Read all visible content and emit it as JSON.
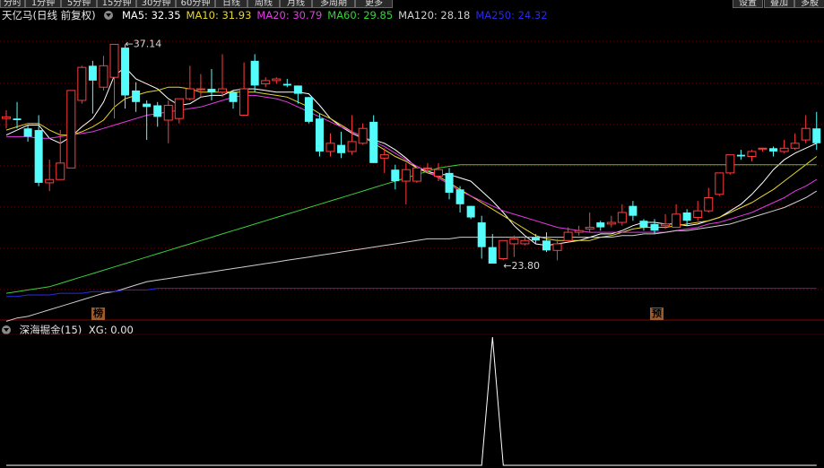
{
  "toolbar": {
    "left_tabs": [
      "分时",
      "1分钟",
      "5分钟",
      "15分钟",
      "30分钟",
      "60分钟",
      "日线",
      "周线",
      "月线",
      "多周期",
      "更多"
    ],
    "right_buttons": [
      "设置",
      "叠加",
      "多股"
    ]
  },
  "main_legend": {
    "title": "天亿马(日线 前复权)",
    "ma": [
      {
        "label": "MA5: 32.35",
        "color": "#ffffff"
      },
      {
        "label": "MA10: 31.93",
        "color": "#e6d52e"
      },
      {
        "label": "MA20: 30.79",
        "color": "#e43ae4"
      },
      {
        "label": "MA60: 29.85",
        "color": "#3ad03a"
      },
      {
        "label": "MA120: 28.18",
        "color": "#cfcfcf"
      },
      {
        "label": "MA250: 24.32",
        "color": "#2a2ae6"
      }
    ]
  },
  "sub_legend": {
    "title": "深海掘金(15)",
    "xg": "XG: 0.00"
  },
  "annotations": {
    "high": "37.14",
    "low": "23.80"
  },
  "markers": [
    "榜",
    "预"
  ],
  "colors": {
    "up": "#ff3c3c",
    "down": "#54fcfc",
    "grid": "#7a0000",
    "background": "#000000"
  },
  "chart_data": [
    {
      "type": "candlestick",
      "title": "天亿马(日线 前复权)",
      "ylim": [
        21.3,
        38.7
      ],
      "series": [
        {
          "name": "K",
          "ohlc": [
            [
              32.6,
              33.1,
              32.7,
              32.0
            ],
            [
              32.6,
              33.6,
              32.5,
              32.0
            ],
            [
              32.0,
              32.2,
              31.5,
              31.2
            ],
            [
              31.9,
              32.8,
              28.7,
              28.5
            ],
            [
              28.7,
              30.1,
              28.9,
              28.2
            ],
            [
              28.9,
              31.9,
              29.9,
              29.6
            ],
            [
              29.6,
              34.3,
              34.3,
              29.6
            ],
            [
              33.7,
              35.8,
              35.7,
              33.5
            ],
            [
              35.8,
              36.1,
              34.9,
              32.9
            ],
            [
              34.5,
              36.4,
              35.8,
              34.3
            ],
            [
              35.1,
              37.1,
              37.1,
              32.6
            ],
            [
              36.9,
              37.1,
              34.0,
              33.2
            ],
            [
              34.3,
              34.8,
              33.6,
              33.0
            ],
            [
              33.5,
              33.7,
              33.3,
              31.3
            ],
            [
              33.4,
              33.6,
              32.7,
              32.1
            ],
            [
              32.5,
              33.7,
              33.4,
              31.1
            ],
            [
              32.6,
              33.6,
              33.8,
              32.3
            ],
            [
              33.8,
              35.8,
              34.4,
              33.7
            ],
            [
              34.4,
              35.3,
              34.4,
              33.9
            ],
            [
              34.4,
              35.6,
              34.2,
              33.7
            ],
            [
              34.2,
              36.5,
              34.4,
              33.9
            ],
            [
              34.2,
              34.3,
              33.6,
              33.2
            ],
            [
              32.8,
              36.0,
              34.4,
              32.8
            ],
            [
              36.1,
              36.5,
              34.6,
              34.2
            ],
            [
              34.7,
              35.1,
              34.9,
              34.5
            ],
            [
              34.9,
              35.1,
              35.0,
              34.7
            ],
            [
              34.7,
              35.0,
              34.6,
              34.5
            ],
            [
              34.6,
              34.6,
              34.1,
              33.5
            ],
            [
              33.9,
              33.9,
              32.4,
              32.3
            ],
            [
              32.6,
              32.9,
              30.6,
              30.3
            ],
            [
              30.6,
              31.7,
              31.1,
              30.3
            ],
            [
              31.0,
              31.8,
              30.5,
              30.2
            ],
            [
              30.6,
              32.8,
              31.2,
              30.4
            ],
            [
              31.1,
              32.3,
              32.0,
              31.0
            ],
            [
              32.4,
              32.8,
              29.9,
              29.9
            ],
            [
              30.2,
              30.8,
              30.4,
              29.3
            ],
            [
              29.5,
              29.8,
              28.8,
              28.3
            ],
            [
              28.8,
              29.9,
              29.5,
              27.4
            ],
            [
              28.8,
              29.6,
              29.6,
              28.7
            ],
            [
              29.6,
              29.9,
              29.6,
              29.4
            ],
            [
              29.1,
              29.9,
              29.5,
              28.8
            ],
            [
              29.3,
              29.6,
              28.1,
              27.7
            ],
            [
              28.3,
              28.5,
              27.4,
              26.9
            ],
            [
              27.3,
              27.3,
              26.6,
              26.5
            ],
            [
              26.3,
              26.7,
              24.8,
              24.1
            ],
            [
              24.8,
              25.6,
              23.8,
              23.8
            ],
            [
              24.1,
              25.0,
              25.2,
              24.0
            ],
            [
              25.0,
              25.5,
              25.3,
              24.2
            ],
            [
              25.0,
              25.5,
              25.2,
              24.9
            ],
            [
              25.4,
              25.6,
              25.2,
              25.0
            ],
            [
              25.2,
              25.7,
              24.6,
              24.5
            ],
            [
              24.6,
              25.3,
              25.0,
              24.0
            ],
            [
              25.2,
              26.0,
              25.7,
              25.1
            ],
            [
              25.7,
              26.1,
              25.8,
              25.5
            ],
            [
              25.9,
              26.9,
              26.0,
              25.7
            ],
            [
              26.3,
              26.4,
              26.0,
              25.8
            ],
            [
              26.2,
              26.7,
              26.3,
              26.0
            ],
            [
              26.3,
              27.4,
              26.9,
              26.1
            ],
            [
              27.3,
              27.6,
              26.7,
              26.4
            ],
            [
              26.4,
              26.5,
              26.0,
              25.8
            ],
            [
              26.2,
              26.5,
              25.8,
              25.6
            ],
            [
              26.1,
              26.8,
              26.2,
              25.9
            ],
            [
              26.0,
              27.4,
              26.8,
              26.0
            ],
            [
              26.9,
              27.1,
              26.4,
              26.1
            ],
            [
              26.6,
              27.6,
              27.0,
              26.4
            ],
            [
              27.0,
              28.4,
              27.8,
              26.9
            ],
            [
              28.0,
              29.1,
              29.3,
              27.9
            ],
            [
              29.3,
              30.4,
              30.4,
              29.2
            ],
            [
              30.4,
              30.7,
              30.3,
              30.1
            ],
            [
              30.3,
              30.7,
              30.6,
              30.0
            ],
            [
              30.8,
              30.8,
              30.8,
              30.6
            ],
            [
              30.8,
              30.9,
              30.6,
              30.3
            ],
            [
              30.6,
              31.3,
              30.8,
              30.5
            ],
            [
              30.8,
              31.7,
              31.1,
              30.7
            ],
            [
              31.3,
              32.8,
              32.0,
              31.1
            ],
            [
              32.0,
              33.0,
              31.1,
              30.7
            ]
          ]
        },
        {
          "name": "MA5",
          "values": [
            31.6,
            31.9,
            32.2,
            32.2,
            31.4,
            31.1,
            31.5,
            32.1,
            32.6,
            33.6,
            35.2,
            35.7,
            35.0,
            34.7,
            34.4,
            33.8,
            33.4,
            33.5,
            33.9,
            34.0,
            34.0,
            34.3,
            34.4,
            34.4,
            34.3,
            34.2,
            34.2,
            34.2,
            34.1,
            33.4,
            32.6,
            32.1,
            31.7,
            31.4,
            31.3,
            31.1,
            30.7,
            30.2,
            29.6,
            29.4,
            29.2,
            29.2,
            29.0,
            28.8,
            28.2,
            27.6,
            26.9,
            26.1,
            25.5,
            25.0,
            24.9,
            25.0,
            25.1,
            25.2,
            25.4,
            25.6,
            25.6,
            25.8,
            26.1,
            26.3,
            26.3,
            26.2,
            26.2,
            26.1,
            26.2,
            26.4,
            26.6,
            27.0,
            27.4,
            28.0,
            28.7,
            29.5,
            30.1,
            30.5,
            30.8,
            31.1
          ]
        },
        {
          "name": "MA10",
          "values": [
            31.9,
            32.1,
            32.3,
            32.3,
            31.9,
            31.6,
            31.6,
            31.8,
            32.1,
            32.5,
            33.3,
            33.8,
            34.0,
            34.2,
            34.3,
            34.5,
            34.5,
            34.4,
            34.2,
            34.2,
            34.2,
            34.2,
            34.2,
            34.2,
            34.1,
            34.0,
            33.9,
            33.6,
            33.3,
            32.9,
            32.6,
            32.2,
            31.8,
            31.5,
            31.1,
            30.7,
            30.3,
            30.0,
            29.6,
            29.3,
            29.1,
            28.7,
            28.3,
            27.9,
            27.5,
            27.1,
            26.7,
            26.3,
            25.9,
            25.5,
            25.3,
            25.2,
            25.2,
            25.2,
            25.2,
            25.4,
            25.5,
            25.7,
            25.9,
            26.0,
            26.0,
            26.0,
            26.1,
            26.2,
            26.3,
            26.4,
            26.6,
            26.9,
            27.2,
            27.5,
            27.9,
            28.3,
            28.8,
            29.3,
            29.8,
            30.3
          ]
        },
        {
          "name": "MA20",
          "values": [
            31.5,
            31.5,
            31.5,
            31.4,
            31.4,
            31.5,
            31.6,
            31.7,
            31.8,
            32.0,
            32.2,
            32.4,
            32.6,
            32.8,
            32.9,
            33.0,
            33.1,
            33.2,
            33.3,
            33.5,
            33.7,
            33.9,
            34.0,
            34.0,
            33.9,
            33.8,
            33.6,
            33.3,
            33.0,
            32.7,
            32.4,
            32.1,
            31.8,
            31.5,
            31.2,
            30.9,
            30.5,
            30.1,
            29.7,
            29.4,
            29.0,
            28.6,
            28.2,
            27.9,
            27.6,
            27.3,
            27.0,
            26.8,
            26.6,
            26.4,
            26.2,
            26.0,
            25.9,
            25.8,
            25.7,
            25.7,
            25.7,
            25.7,
            25.7,
            25.7,
            25.7,
            25.7,
            25.8,
            25.9,
            26.0,
            26.2,
            26.3,
            26.5,
            26.7,
            26.9,
            27.2,
            27.5,
            27.8,
            28.2,
            28.5,
            28.9
          ]
        },
        {
          "name": "MA60",
          "values": [
            22.0,
            22.1,
            22.2,
            22.3,
            22.4,
            22.6,
            22.8,
            23.0,
            23.2,
            23.4,
            23.6,
            23.8,
            24.0,
            24.2,
            24.4,
            24.6,
            24.8,
            25.0,
            25.2,
            25.4,
            25.6,
            25.8,
            26.0,
            26.2,
            26.4,
            26.6,
            26.8,
            27.0,
            27.2,
            27.4,
            27.6,
            27.8,
            28.0,
            28.2,
            28.4,
            28.6,
            28.8,
            29.0,
            29.2,
            29.4,
            29.6,
            29.7,
            29.8,
            29.8,
            29.8,
            29.8,
            29.8,
            29.8,
            29.8,
            29.8,
            29.8,
            29.8,
            29.8,
            29.8,
            29.8,
            29.8,
            29.8,
            29.8,
            29.8,
            29.8,
            29.8,
            29.8,
            29.8,
            29.8,
            29.8,
            29.8,
            29.8,
            29.8,
            29.8,
            29.8,
            29.8,
            29.8,
            29.8,
            29.8,
            29.8,
            29.8
          ]
        },
        {
          "name": "MA120",
          "values": [
            20.3,
            20.5,
            20.6,
            20.8,
            21.0,
            21.2,
            21.4,
            21.6,
            21.8,
            22.0,
            22.1,
            22.3,
            22.5,
            22.7,
            22.8,
            22.9,
            23.0,
            23.1,
            23.2,
            23.3,
            23.4,
            23.5,
            23.6,
            23.7,
            23.8,
            23.9,
            24.0,
            24.1,
            24.2,
            24.3,
            24.4,
            24.5,
            24.6,
            24.7,
            24.8,
            24.9,
            25.0,
            25.1,
            25.2,
            25.3,
            25.3,
            25.3,
            25.4,
            25.4,
            25.4,
            25.4,
            25.4,
            25.4,
            25.4,
            25.4,
            25.4,
            25.4,
            25.4,
            25.4,
            25.4,
            25.4,
            25.4,
            25.5,
            25.5,
            25.6,
            25.6,
            25.7,
            25.8,
            25.8,
            25.9,
            26.0,
            26.1,
            26.2,
            26.4,
            26.6,
            26.8,
            27.0,
            27.2,
            27.5,
            27.8,
            28.2
          ]
        },
        {
          "name": "MA250",
          "values": [
            21.8,
            21.8,
            21.9,
            21.9,
            21.9,
            22.0,
            22.0,
            22.0,
            22.1,
            22.1,
            22.1,
            22.2,
            22.2,
            22.2,
            22.3,
            22.3,
            22.3,
            22.3,
            22.3,
            22.3,
            22.3,
            22.3,
            22.3,
            22.3,
            22.3,
            22.3,
            22.3,
            22.3,
            22.3,
            22.3,
            22.3,
            22.3,
            22.3,
            22.3,
            22.3,
            22.3,
            22.3,
            22.3,
            22.3,
            22.3,
            22.3,
            22.3,
            22.3,
            22.3,
            22.3,
            22.3,
            22.3,
            22.3,
            22.3,
            22.3,
            22.3,
            22.3,
            22.3,
            22.3,
            22.3,
            22.3,
            22.3,
            22.3,
            22.3,
            22.3,
            22.3,
            22.3,
            22.3,
            22.3,
            22.3,
            22.3,
            22.3,
            22.3,
            22.3,
            22.3,
            22.3,
            22.3,
            22.3,
            22.3,
            22.3,
            22.3
          ]
        }
      ],
      "annotations": [
        {
          "label": "37.14",
          "value": 37.14,
          "bar": 10
        },
        {
          "label": "23.80",
          "value": 23.8,
          "bar": 45
        }
      ],
      "markers": [
        {
          "label": "榜",
          "bar": 10
        },
        {
          "label": "预",
          "bar": 65
        }
      ]
    },
    {
      "type": "line",
      "title": "深海掘金(15)",
      "ylim": [
        0,
        1
      ],
      "series": [
        {
          "name": "XG",
          "values": [
            0,
            0,
            0,
            0,
            0,
            0,
            0,
            0,
            0,
            0,
            0,
            0,
            0,
            0,
            0,
            0,
            0,
            0,
            0,
            0,
            0,
            0,
            0,
            0,
            0,
            0,
            0,
            0,
            0,
            0,
            0,
            0,
            0,
            0,
            0,
            0,
            0,
            0,
            0,
            0,
            0,
            0,
            0,
            0,
            0,
            1,
            0,
            0,
            0,
            0,
            0,
            0,
            0,
            0,
            0,
            0,
            0,
            0,
            0,
            0,
            0,
            0,
            0,
            0,
            0,
            0,
            0,
            0,
            0,
            0,
            0,
            0,
            0,
            0,
            0,
            0
          ]
        }
      ]
    }
  ]
}
